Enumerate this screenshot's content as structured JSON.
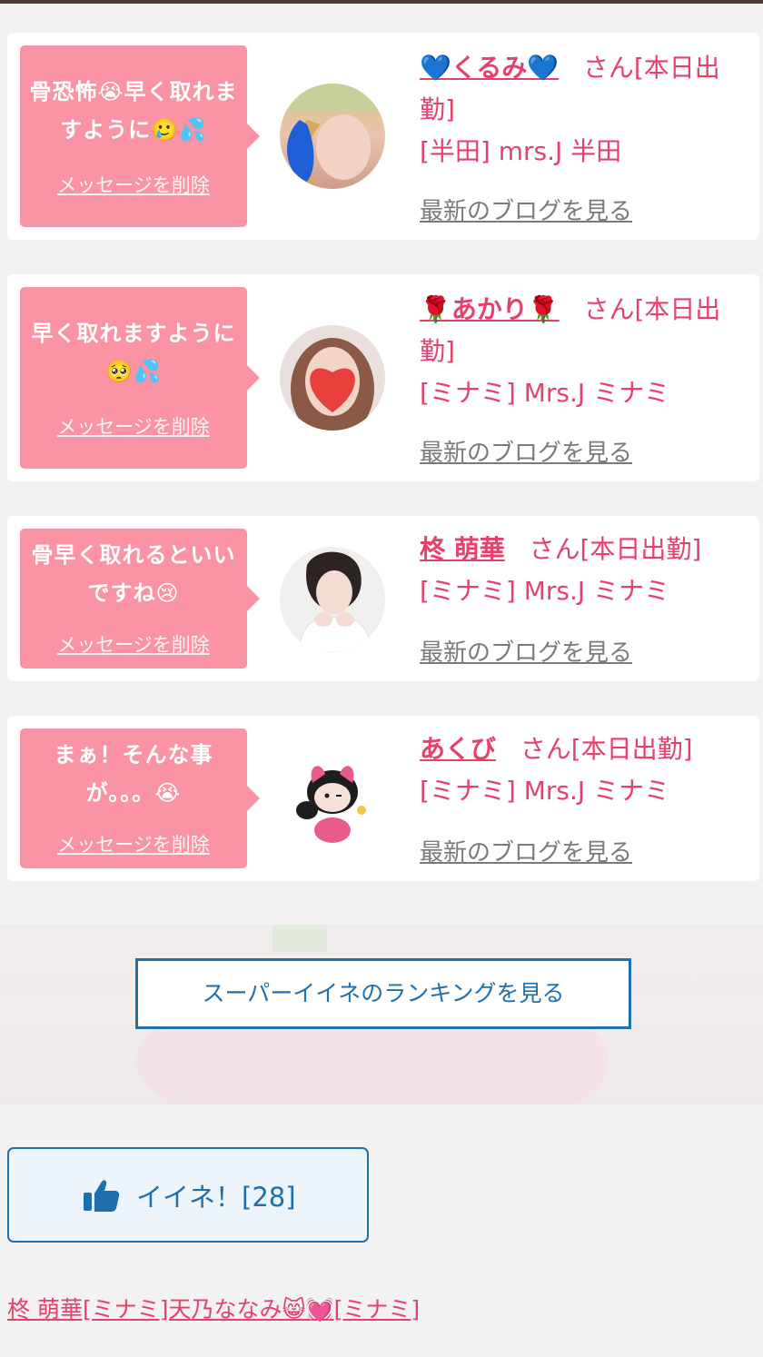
{
  "messages": [
    {
      "bubble_text": "骨恐怖😭早く取れますように🥲💦",
      "delete_label": "メッセージを削除",
      "name": "💙くるみ💙",
      "san_prefix": "さん[本日出",
      "san_suffix": "勤]",
      "shop": "[半田] mrs.J 半田",
      "blog_label": "最新のブログを見る"
    },
    {
      "bubble_text": "早く取れますように🥺💦",
      "delete_label": "メッセージを削除",
      "name": "🌹あかり🌹",
      "san_prefix": "さん[本日出",
      "san_suffix": "勤]",
      "shop": "[ミナミ] Mrs.J ミナミ",
      "blog_label": "最新のブログを見る"
    },
    {
      "bubble_text": "骨早く取れるといいですね😢",
      "delete_label": "メッセージを削除",
      "name": "柊 萌華",
      "san_full": "さん[本日出勤]",
      "shop": "[ミナミ] Mrs.J ミナミ",
      "blog_label": "最新のブログを見る"
    },
    {
      "bubble_text": "まぁ！そんな事が。。。😭",
      "delete_label": "メッセージを削除",
      "name": "あくび",
      "san_full": "さん[本日出勤]",
      "shop": "[ミナミ] Mrs.J ミナミ",
      "blog_label": "最新のブログを見る"
    }
  ],
  "ranking_button_label": "スーパーイイネのランキングを見る",
  "iine_button_label": "イイネ！[28]",
  "footer_link_text": "柊 萌華[ミナミ]天乃ななみ😸💓[ミナミ]",
  "colors": {
    "accent_pink": "#e6416b",
    "bubble_pink": "#fa93a3",
    "link_blue": "#1e6fae"
  }
}
